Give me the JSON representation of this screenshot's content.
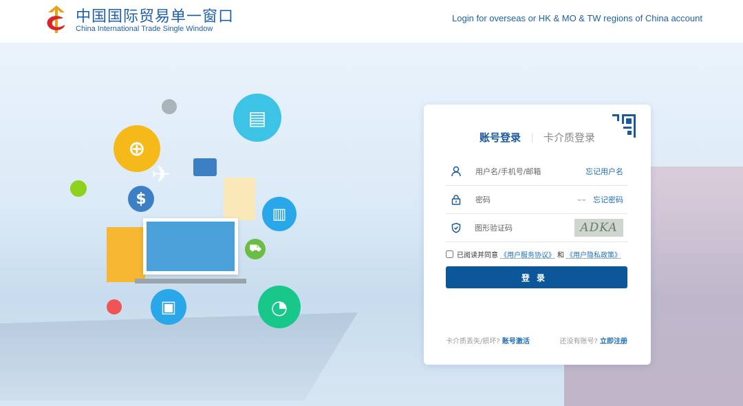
{
  "header": {
    "logo_cn": "中国国际贸易单一窗口",
    "logo_en": "China International Trade Single Window",
    "overseas_link": "Login for overseas or HK & MO & TW regions of China account"
  },
  "login": {
    "tab_account": "账号登录",
    "tab_card": "卡介质登录",
    "username_placeholder": "用户名/手机号/邮箱",
    "forgot_username": "忘记用户名",
    "password_placeholder": "密码",
    "forgot_password": "忘记密码",
    "captcha_placeholder": "图形验证码",
    "captcha_text": "ADKA",
    "agree_text": "已阅读并同意",
    "service_agreement": "《用户服务协议》",
    "and": "和",
    "privacy_policy": "《用户隐私政策》",
    "login_button": "登录",
    "card_lost": "卡介质丢失/损坏?",
    "activate": "账号激活",
    "no_account": "还没有账号?",
    "register": "立即注册"
  },
  "colors": {
    "primary": "#0b5799",
    "link": "#1f6fb8"
  }
}
